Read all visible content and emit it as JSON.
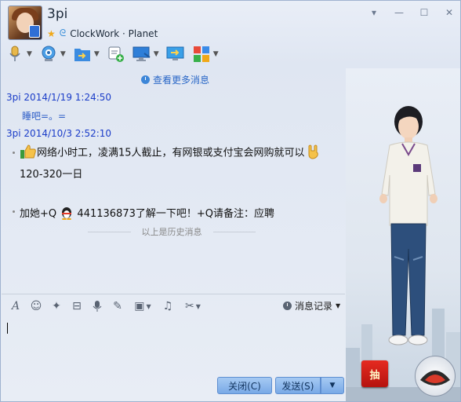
{
  "header": {
    "contact_name": "3pi",
    "subtitle": "ClockWork · Planet",
    "window_controls": [
      "▾",
      "—",
      "☐",
      "✕"
    ]
  },
  "toolbar": {
    "items": [
      "microphone-icon",
      "video-camera-icon",
      "send-file-icon",
      "add-note-icon",
      "remote-desktop-icon",
      "share-screen-icon",
      "apps-grid-icon"
    ]
  },
  "chat": {
    "view_more": "查看更多消息",
    "messages": [
      {
        "sender": "3pi",
        "time": "2014/1/19 1:24:50",
        "text": "睡吧=。="
      },
      {
        "sender": "3pi",
        "time": "2014/10/3 2:52:10",
        "line1": "网络小时工，凌满15人截止，有网银或支付宝会网购就可以",
        "line2": "120-320一日",
        "line3_prefix": "加她+Q",
        "line3_suffix": "441136873了解一下吧！+Q请备注：应聘"
      }
    ],
    "history_label": "以上是历史消息"
  },
  "input_toolbar": {
    "records_label": "消息记录"
  },
  "buttons": {
    "close": "关闭(C)",
    "send": "发送(S)"
  },
  "side_panel": {
    "lottery": "抽"
  },
  "colors": {
    "accent": "#2a67c7",
    "sender": "#1a3cc8",
    "button": "#79a9e6"
  }
}
